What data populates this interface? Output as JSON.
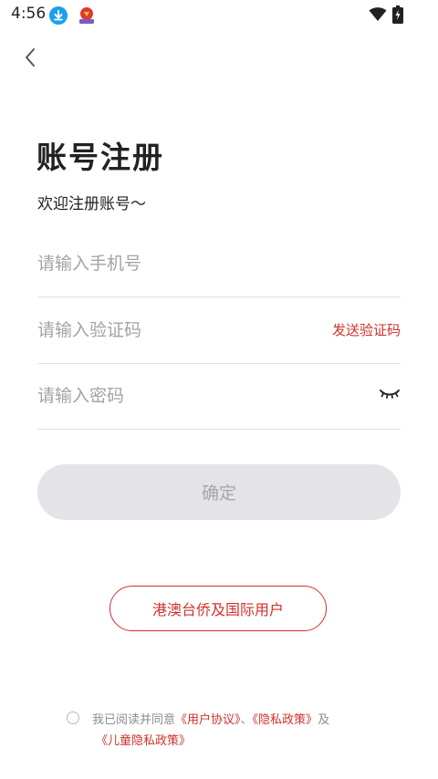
{
  "status_bar": {
    "time": "4:56"
  },
  "icons": {
    "back": "chevron-left-icon",
    "download": "download-icon",
    "app": "app-logo-icon",
    "wifi": "wifi-icon",
    "battery": "battery-charging-icon",
    "eye": "eye-closed-icon",
    "checkbox": "radio-circle-icon"
  },
  "page": {
    "title": "账号注册",
    "subtitle": "欢迎注册账号～"
  },
  "form": {
    "phone_placeholder": "请输入手机号",
    "code_placeholder": "请输入验证码",
    "send_code_label": "发送验证码",
    "password_placeholder": "请输入密码",
    "confirm_label": "确定"
  },
  "intl_button": {
    "label": "港澳台侨及国际用户"
  },
  "agreement": {
    "prefix": "我已阅读并同意",
    "user_agreement": "《用户协议》",
    "separator": "、",
    "privacy_policy": "《隐私政策》",
    "and": "及",
    "children_privacy": "《儿童隐私政策》"
  },
  "colors": {
    "accent": "#d0312d",
    "button_disabled_bg": "#e3e3e8",
    "button_disabled_text": "#a5a5ad",
    "placeholder": "#a3a3a3",
    "divider": "#e2e2e2"
  }
}
